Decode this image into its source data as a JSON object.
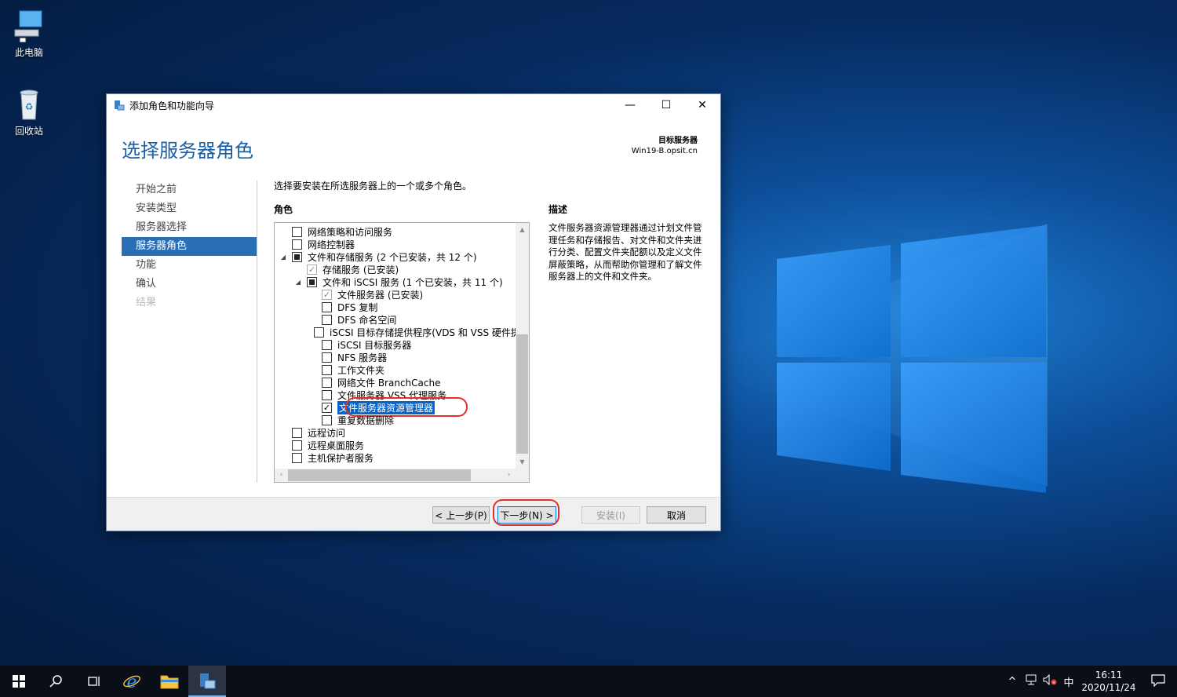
{
  "desktop": {
    "icons": [
      {
        "label": "此电脑",
        "icon": "this-pc-icon"
      },
      {
        "label": "回收站",
        "icon": "recycle-bin-icon"
      }
    ]
  },
  "window": {
    "title": "添加角色和功能向导",
    "page_title": "选择服务器角色",
    "target_label": "目标服务器",
    "target_server": "Win19-B.opsit.cn",
    "nav": [
      {
        "label": "开始之前",
        "state": "normal"
      },
      {
        "label": "安装类型",
        "state": "normal"
      },
      {
        "label": "服务器选择",
        "state": "normal"
      },
      {
        "label": "服务器角色",
        "state": "active"
      },
      {
        "label": "功能",
        "state": "normal"
      },
      {
        "label": "确认",
        "state": "normal"
      },
      {
        "label": "结果",
        "state": "disabled"
      }
    ],
    "instruction": "选择要安装在所选服务器上的一个或多个角色。",
    "roles_header": "角色",
    "description_header": "描述",
    "description": "文件服务器资源管理器通过计划文件管理任务和存储报告、对文件和文件夹进行分类、配置文件夹配额以及定义文件屏蔽策略，从而帮助你管理和了解文件服务器上的文件和文件夹。",
    "roles": [
      {
        "label": "网络策略和访问服务",
        "indent": 0,
        "state": "unchecked",
        "expander": ""
      },
      {
        "label": "网络控制器",
        "indent": 0,
        "state": "unchecked",
        "expander": ""
      },
      {
        "label": "文件和存储服务 (2 个已安装，共 12 个)",
        "indent": 0,
        "state": "partial",
        "expander": "◢"
      },
      {
        "label": "存储服务 (已安装)",
        "indent": 1,
        "state": "checked-disabled",
        "expander": ""
      },
      {
        "label": "文件和 iSCSI 服务 (1 个已安装，共 11 个)",
        "indent": 1,
        "state": "partial",
        "expander": "◢"
      },
      {
        "label": "文件服务器 (已安装)",
        "indent": 2,
        "state": "checked-disabled",
        "expander": ""
      },
      {
        "label": "DFS 复制",
        "indent": 2,
        "state": "unchecked",
        "expander": ""
      },
      {
        "label": "DFS 命名空间",
        "indent": 2,
        "state": "unchecked",
        "expander": ""
      },
      {
        "label": "iSCSI 目标存储提供程序(VDS 和 VSS 硬件提供程序)",
        "indent": 2,
        "state": "unchecked",
        "expander": ""
      },
      {
        "label": "iSCSI 目标服务器",
        "indent": 2,
        "state": "unchecked",
        "expander": ""
      },
      {
        "label": "NFS 服务器",
        "indent": 2,
        "state": "unchecked",
        "expander": ""
      },
      {
        "label": "工作文件夹",
        "indent": 2,
        "state": "unchecked",
        "expander": ""
      },
      {
        "label": "网络文件 BranchCache",
        "indent": 2,
        "state": "unchecked",
        "expander": ""
      },
      {
        "label": "文件服务器 VSS 代理服务",
        "indent": 2,
        "state": "unchecked",
        "expander": ""
      },
      {
        "label": "文件服务器资源管理器",
        "indent": 2,
        "state": "checked",
        "expander": "",
        "selected": true
      },
      {
        "label": "重复数据删除",
        "indent": 2,
        "state": "unchecked",
        "expander": ""
      },
      {
        "label": "远程访问",
        "indent": 0,
        "state": "unchecked",
        "expander": ""
      },
      {
        "label": "远程桌面服务",
        "indent": 0,
        "state": "unchecked",
        "expander": ""
      },
      {
        "label": "主机保护者服务",
        "indent": 0,
        "state": "unchecked",
        "expander": ""
      }
    ],
    "buttons": {
      "prev": "< 上一步(P)",
      "next": "下一步(N) >",
      "install": "安装(I)",
      "cancel": "取消"
    }
  },
  "taskbar": {
    "clock_time": "16:11",
    "clock_date": "2020/11/24",
    "ime": "中"
  },
  "colors": {
    "accent": "#2a6fb6",
    "title_blue": "#1a5fa8",
    "selection": "#0a64c8",
    "highlight_ring": "#e03030"
  }
}
